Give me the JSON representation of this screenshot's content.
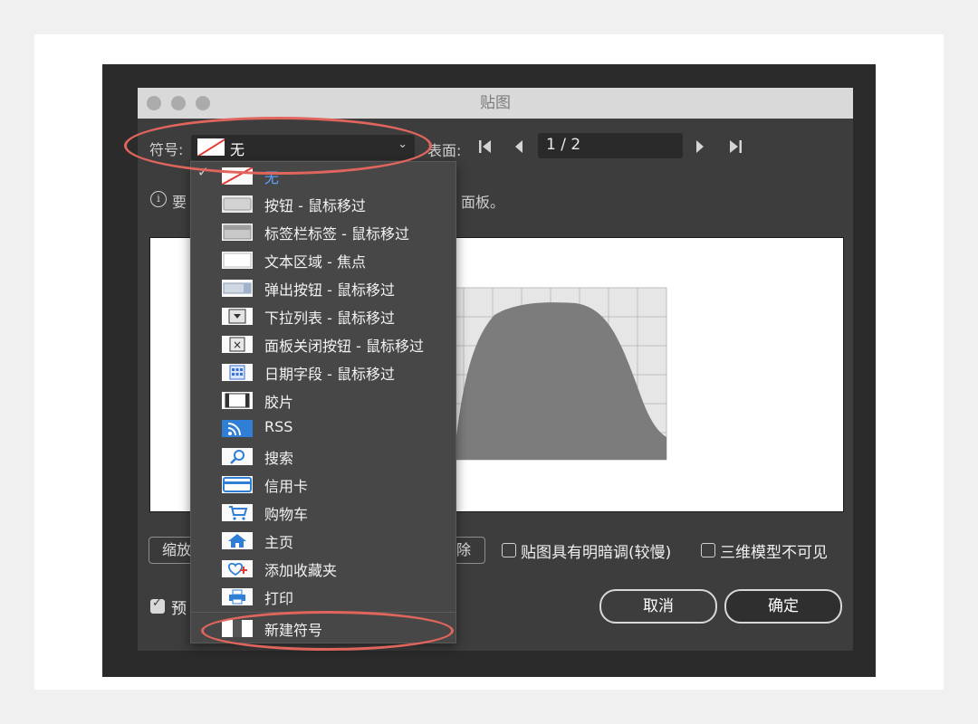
{
  "window": {
    "title": "贴图"
  },
  "toolbar": {
    "symbol_label": "符号:",
    "symbol_value": "无",
    "surface_label": "表面:",
    "page_value": "1 / 2",
    "first_glyph": "⏮",
    "prev_glyph": "◀",
    "next_glyph": "▶",
    "last_glyph": "⏭"
  },
  "info": {
    "icon": "i",
    "text_start": "要",
    "text_end": "面板。"
  },
  "bottom": {
    "scale_button": "缩放",
    "clear_button": "除",
    "shade_label": "贴图具有明暗调(较慢)",
    "invisible_label": "三维模型不可见",
    "preview_label": "预",
    "cancel_button": "取消",
    "ok_button": "确定"
  },
  "menu": {
    "items": [
      {
        "label": "无",
        "icon": "none-swatch-icon",
        "selected": true
      },
      {
        "label": "按钮 - 鼠标移过",
        "icon": "button-icon"
      },
      {
        "label": "标签栏标签 - 鼠标移过",
        "icon": "tab-icon"
      },
      {
        "label": "文本区域 - 焦点",
        "icon": "text-area-icon"
      },
      {
        "label": "弹出按钮 - 鼠标移过",
        "icon": "popup-button-icon"
      },
      {
        "label": "下拉列表 - 鼠标移过",
        "icon": "dropdown-icon"
      },
      {
        "label": "面板关闭按钮 - 鼠标移过",
        "icon": "close-panel-icon"
      },
      {
        "label": "日期字段 - 鼠标移过",
        "icon": "calendar-icon"
      },
      {
        "label": "胶片",
        "icon": "film-icon"
      },
      {
        "label": "RSS",
        "icon": "rss-icon"
      },
      {
        "label": "搜索",
        "icon": "search-icon"
      },
      {
        "label": "信用卡",
        "icon": "credit-card-icon"
      },
      {
        "label": "购物车",
        "icon": "cart-icon"
      },
      {
        "label": "主页",
        "icon": "home-icon"
      },
      {
        "label": "添加收藏夹",
        "icon": "favorite-add-icon"
      },
      {
        "label": "打印",
        "icon": "printer-icon"
      },
      {
        "label": "新建符号",
        "icon": "new-symbol-icon"
      }
    ]
  },
  "colors": {
    "accent_selected": "#5aa2ff",
    "annotation": "#e0655d"
  }
}
